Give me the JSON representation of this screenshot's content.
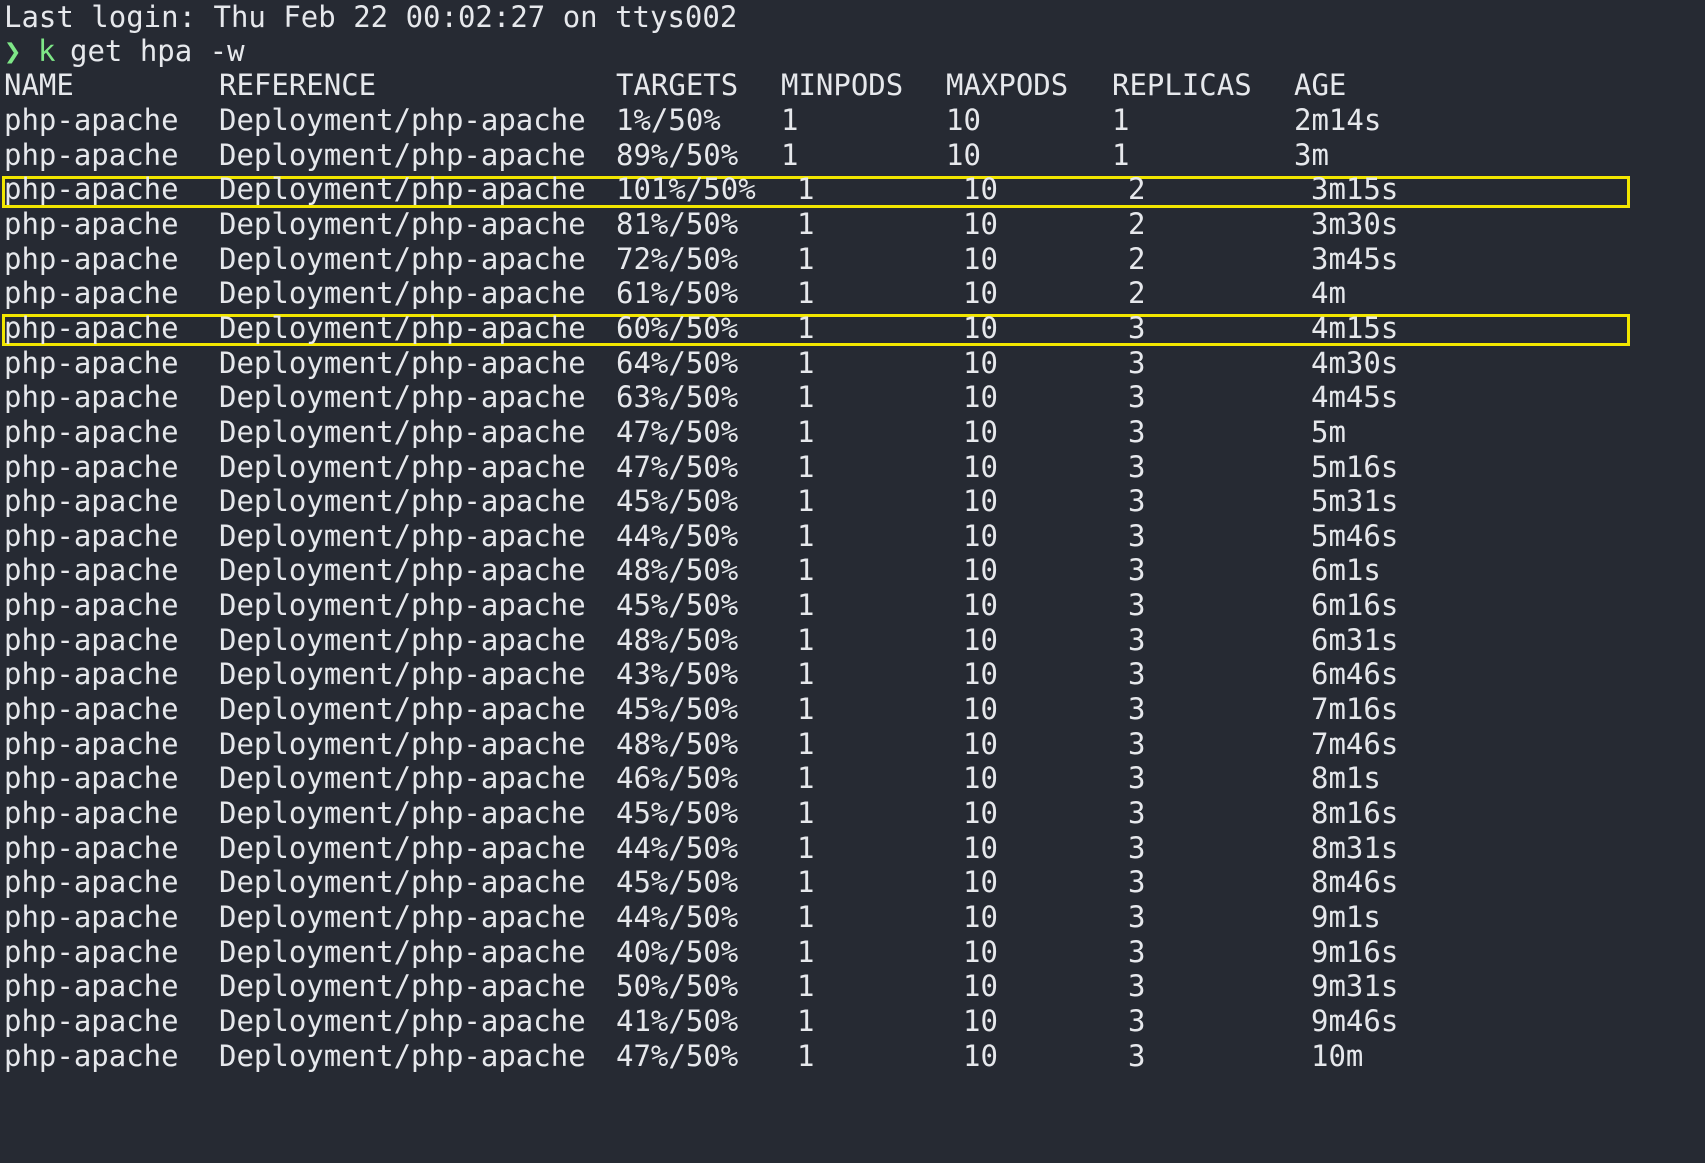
{
  "terminal": {
    "last_login": "Last login: Thu Feb 22 00:02:27 on ttys002",
    "prompt_symbol": "❯",
    "command_alias": "k",
    "command_args": "get hpa -w",
    "headers": [
      "NAME",
      "REFERENCE",
      "TARGETS",
      "MINPODS",
      "MAXPODS",
      "REPLICAS",
      "AGE"
    ],
    "rows": [
      {
        "name": "php-apache",
        "reference": "Deployment/php-apache",
        "targets": "1%/50%",
        "minpods": "1",
        "maxpods": "10",
        "replicas": "1",
        "age": "2m14s"
      },
      {
        "name": "php-apache",
        "reference": "Deployment/php-apache",
        "targets": "89%/50%",
        "minpods": "1",
        "maxpods": "10",
        "replicas": "1",
        "age": "3m"
      },
      {
        "name": "php-apache",
        "reference": "Deployment/php-apache",
        "targets": "101%/50%",
        "minpods": "1",
        "maxpods": "10",
        "replicas": "2",
        "age": "3m15s"
      },
      {
        "name": "php-apache",
        "reference": "Deployment/php-apache",
        "targets": "81%/50%",
        "minpods": "1",
        "maxpods": "10",
        "replicas": "2",
        "age": "3m30s"
      },
      {
        "name": "php-apache",
        "reference": "Deployment/php-apache",
        "targets": "72%/50%",
        "minpods": "1",
        "maxpods": "10",
        "replicas": "2",
        "age": "3m45s"
      },
      {
        "name": "php-apache",
        "reference": "Deployment/php-apache",
        "targets": "61%/50%",
        "minpods": "1",
        "maxpods": "10",
        "replicas": "2",
        "age": "4m"
      },
      {
        "name": "php-apache",
        "reference": "Deployment/php-apache",
        "targets": "60%/50%",
        "minpods": "1",
        "maxpods": "10",
        "replicas": "3",
        "age": "4m15s"
      },
      {
        "name": "php-apache",
        "reference": "Deployment/php-apache",
        "targets": "64%/50%",
        "minpods": "1",
        "maxpods": "10",
        "replicas": "3",
        "age": "4m30s"
      },
      {
        "name": "php-apache",
        "reference": "Deployment/php-apache",
        "targets": "63%/50%",
        "minpods": "1",
        "maxpods": "10",
        "replicas": "3",
        "age": "4m45s"
      },
      {
        "name": "php-apache",
        "reference": "Deployment/php-apache",
        "targets": "47%/50%",
        "minpods": "1",
        "maxpods": "10",
        "replicas": "3",
        "age": "5m"
      },
      {
        "name": "php-apache",
        "reference": "Deployment/php-apache",
        "targets": "47%/50%",
        "minpods": "1",
        "maxpods": "10",
        "replicas": "3",
        "age": "5m16s"
      },
      {
        "name": "php-apache",
        "reference": "Deployment/php-apache",
        "targets": "45%/50%",
        "minpods": "1",
        "maxpods": "10",
        "replicas": "3",
        "age": "5m31s"
      },
      {
        "name": "php-apache",
        "reference": "Deployment/php-apache",
        "targets": "44%/50%",
        "minpods": "1",
        "maxpods": "10",
        "replicas": "3",
        "age": "5m46s"
      },
      {
        "name": "php-apache",
        "reference": "Deployment/php-apache",
        "targets": "48%/50%",
        "minpods": "1",
        "maxpods": "10",
        "replicas": "3",
        "age": "6m1s"
      },
      {
        "name": "php-apache",
        "reference": "Deployment/php-apache",
        "targets": "45%/50%",
        "minpods": "1",
        "maxpods": "10",
        "replicas": "3",
        "age": "6m16s"
      },
      {
        "name": "php-apache",
        "reference": "Deployment/php-apache",
        "targets": "48%/50%",
        "minpods": "1",
        "maxpods": "10",
        "replicas": "3",
        "age": "6m31s"
      },
      {
        "name": "php-apache",
        "reference": "Deployment/php-apache",
        "targets": "43%/50%",
        "minpods": "1",
        "maxpods": "10",
        "replicas": "3",
        "age": "6m46s"
      },
      {
        "name": "php-apache",
        "reference": "Deployment/php-apache",
        "targets": "45%/50%",
        "minpods": "1",
        "maxpods": "10",
        "replicas": "3",
        "age": "7m16s"
      },
      {
        "name": "php-apache",
        "reference": "Deployment/php-apache",
        "targets": "48%/50%",
        "minpods": "1",
        "maxpods": "10",
        "replicas": "3",
        "age": "7m46s"
      },
      {
        "name": "php-apache",
        "reference": "Deployment/php-apache",
        "targets": "46%/50%",
        "minpods": "1",
        "maxpods": "10",
        "replicas": "3",
        "age": "8m1s"
      },
      {
        "name": "php-apache",
        "reference": "Deployment/php-apache",
        "targets": "45%/50%",
        "minpods": "1",
        "maxpods": "10",
        "replicas": "3",
        "age": "8m16s"
      },
      {
        "name": "php-apache",
        "reference": "Deployment/php-apache",
        "targets": "44%/50%",
        "minpods": "1",
        "maxpods": "10",
        "replicas": "3",
        "age": "8m31s"
      },
      {
        "name": "php-apache",
        "reference": "Deployment/php-apache",
        "targets": "45%/50%",
        "minpods": "1",
        "maxpods": "10",
        "replicas": "3",
        "age": "8m46s"
      },
      {
        "name": "php-apache",
        "reference": "Deployment/php-apache",
        "targets": "44%/50%",
        "minpods": "1",
        "maxpods": "10",
        "replicas": "3",
        "age": "9m1s"
      },
      {
        "name": "php-apache",
        "reference": "Deployment/php-apache",
        "targets": "40%/50%",
        "minpods": "1",
        "maxpods": "10",
        "replicas": "3",
        "age": "9m16s"
      },
      {
        "name": "php-apache",
        "reference": "Deployment/php-apache",
        "targets": "50%/50%",
        "minpods": "1",
        "maxpods": "10",
        "replicas": "3",
        "age": "9m31s"
      },
      {
        "name": "php-apache",
        "reference": "Deployment/php-apache",
        "targets": "41%/50%",
        "minpods": "1",
        "maxpods": "10",
        "replicas": "3",
        "age": "9m46s"
      },
      {
        "name": "php-apache",
        "reference": "Deployment/php-apache",
        "targets": "47%/50%",
        "minpods": "1",
        "maxpods": "10",
        "replicas": "3",
        "age": "10m"
      }
    ],
    "highlighted_rows": [
      1,
      5
    ]
  },
  "colors": {
    "background": "#262a33",
    "text": "#e6e8ec",
    "prompt": "#7ee787",
    "highlight": "#f2e600"
  }
}
